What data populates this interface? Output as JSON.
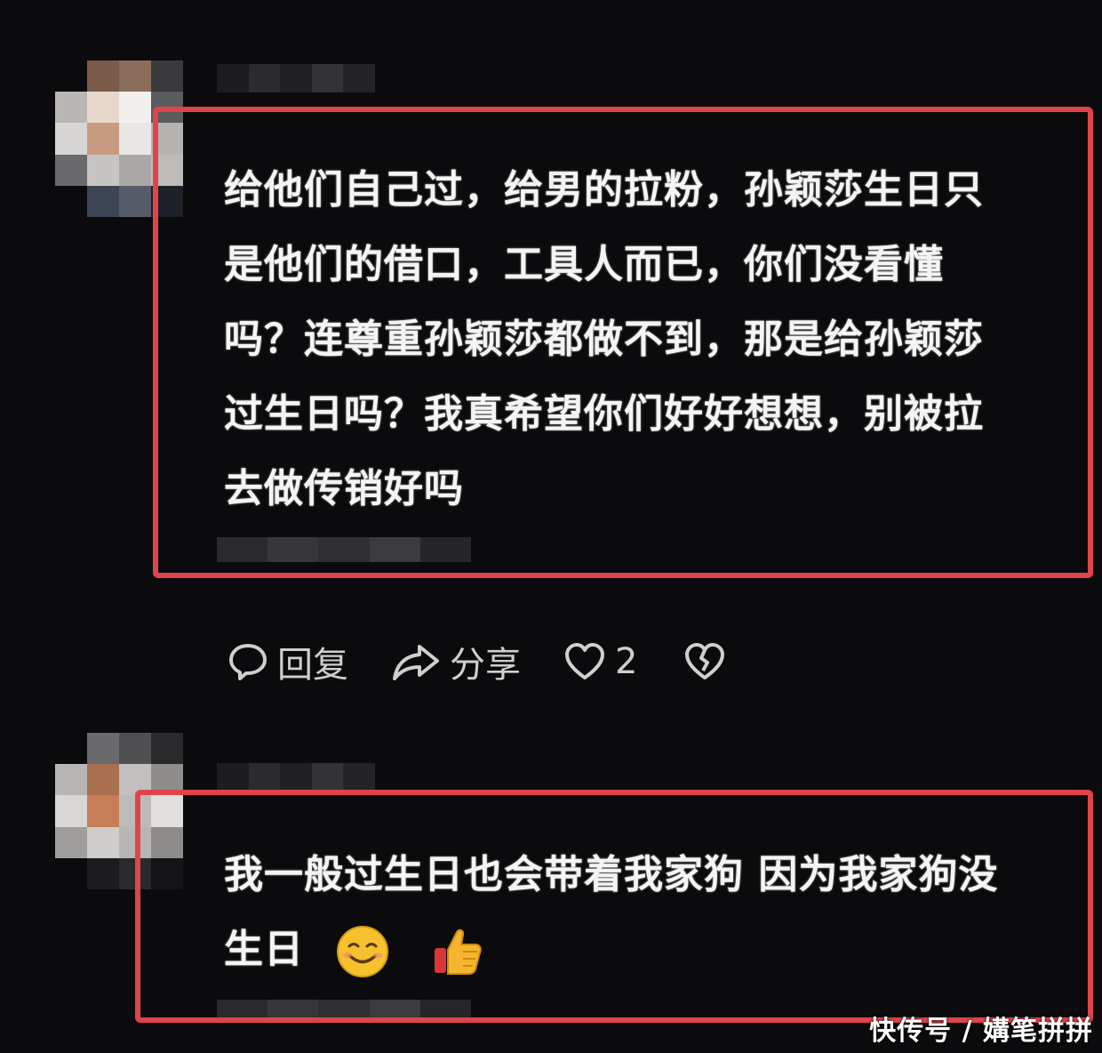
{
  "comments": [
    {
      "text_lines": [
        "给他们自己过，给男的拉粉，孙颖莎生日只",
        "是他们的借口，工具人而已，你们没看懂",
        "吗？连尊重孙颖莎都做不到，那是给孙颖莎",
        "过生日吗？我真希望你们好好想想，别被拉",
        "去做传销好吗"
      ]
    },
    {
      "text_lines": [
        "我一般过生日也会带着我家狗 因为我家狗没",
        "生日"
      ],
      "emojis": [
        "smiling-face-emoji",
        "thumbs-up-emoji"
      ]
    }
  ],
  "actions": {
    "reply_label": "回复",
    "share_label": "分享",
    "like_count": "2"
  },
  "watermark": "快传号 / 媾笔拼拼",
  "colors": {
    "highlight_border": "#e0444a",
    "background": "#0b0b0d"
  }
}
